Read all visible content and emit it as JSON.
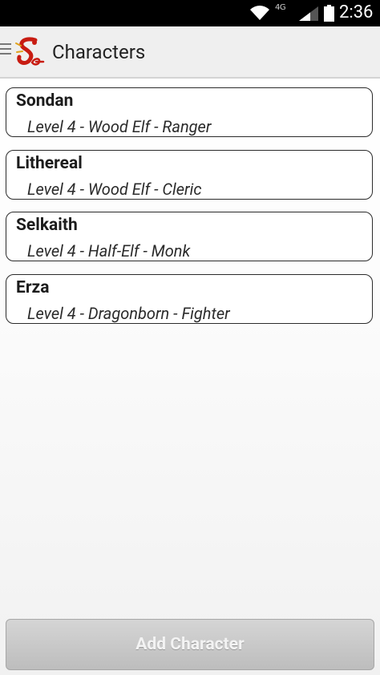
{
  "status_bar": {
    "network_label": "4G",
    "time": "2:36"
  },
  "action_bar": {
    "title": "Characters"
  },
  "characters": [
    {
      "name": "Sondan",
      "description": "Level 4 - Wood Elf - Ranger"
    },
    {
      "name": "Lithereal",
      "description": "Level 4 - Wood Elf - Cleric"
    },
    {
      "name": "Selkaith",
      "description": "Level 4 - Half-Elf - Monk"
    },
    {
      "name": "Erza",
      "description": "Level 4 - Dragonborn - Fighter"
    }
  ],
  "add_button": {
    "label": "Add Character"
  }
}
